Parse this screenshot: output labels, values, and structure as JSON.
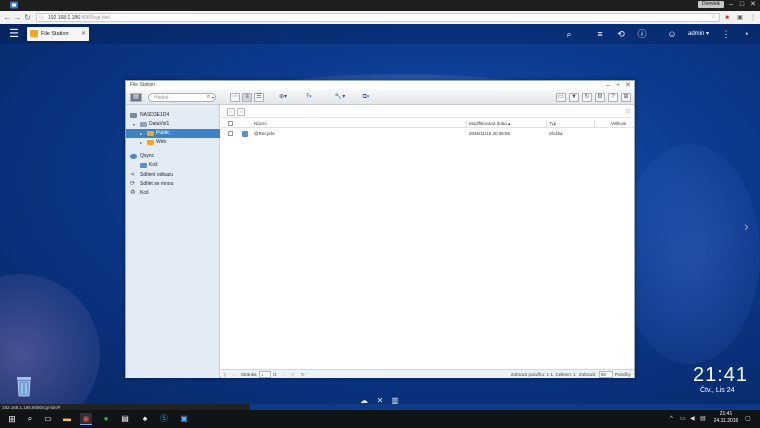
{
  "browser": {
    "url_host": "192.168.1.186",
    "url_rest": ":8080/cgi-bin/",
    "profile_name": "Dominik"
  },
  "qts": {
    "app_tab_label": "File Station",
    "user_label": "admin ▾"
  },
  "file_station": {
    "title": "File Station",
    "search_placeholder": "Hledat",
    "tree": [
      {
        "label": "NASD3E1D4"
      },
      {
        "label": "DataVol1"
      },
      {
        "label": "Public"
      },
      {
        "label": "Web"
      },
      {
        "label": "Qsync"
      },
      {
        "label": "Koš"
      },
      {
        "label": "Sdílení odkazu"
      },
      {
        "label": "Sdílet se mnou"
      },
      {
        "label": "Koš"
      }
    ],
    "columns": {
      "name": "Název",
      "modified": "Modifikovaná doba ▴",
      "type": "Typ",
      "size": "Velikost"
    },
    "rows": [
      {
        "name": "@Recycle",
        "modified": "2016/11/15 20:35:56",
        "type": "Složka",
        "size": ""
      }
    ],
    "status": {
      "page_label": "Stránka",
      "page_value": "1",
      "page_total": "/1",
      "summary": "Zobrazit položku: 1-1, Celkem: 1",
      "show_label": "Zobrazit",
      "show_value": "50",
      "items_label": "Položky"
    }
  },
  "desktop": {
    "clock": "21:41",
    "date": "Čtv., Lis 24"
  },
  "status_bubble": "192.168.1.186:8080/cgi-bin/#",
  "taskbar": {
    "time": "21:41",
    "date": "24.11.2016"
  },
  "colors": {
    "selection": "#3e82c6",
    "folder": "#f5a623",
    "close": "#e0373a"
  }
}
